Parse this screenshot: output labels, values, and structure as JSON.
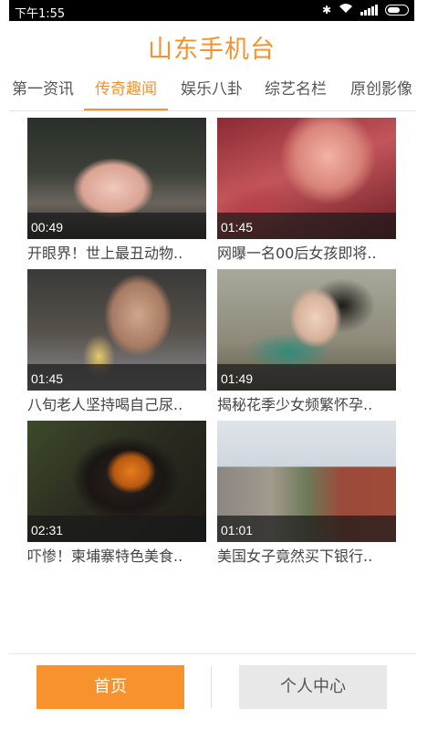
{
  "status_bar": {
    "time": "下午1:55"
  },
  "app": {
    "title": "山东手机台"
  },
  "tabs": [
    {
      "label": "第一资讯"
    },
    {
      "label": "传奇趣闻"
    },
    {
      "label": "娱乐八卦"
    },
    {
      "label": "综艺名栏"
    },
    {
      "label": "原创影像"
    }
  ],
  "videos": [
    {
      "duration": "00:49",
      "title": "开眼界！世上最丑动物.."
    },
    {
      "duration": "01:45",
      "title": "网曝一名00后女孩即将.."
    },
    {
      "duration": "01:45",
      "title": "八旬老人坚持喝自己尿.."
    },
    {
      "duration": "01:49",
      "title": "揭秘花季少女频繁怀孕.."
    },
    {
      "duration": "02:31",
      "title": "吓惨！柬埔寨特色美食.."
    },
    {
      "duration": "01:01",
      "title": "美国女子竟然买下银行.."
    }
  ],
  "bottom_nav": {
    "home_label": "首页",
    "profile_label": "个人中心"
  },
  "colors": {
    "accent": "#f5922e",
    "inactive_button": "#e8e8e8"
  }
}
